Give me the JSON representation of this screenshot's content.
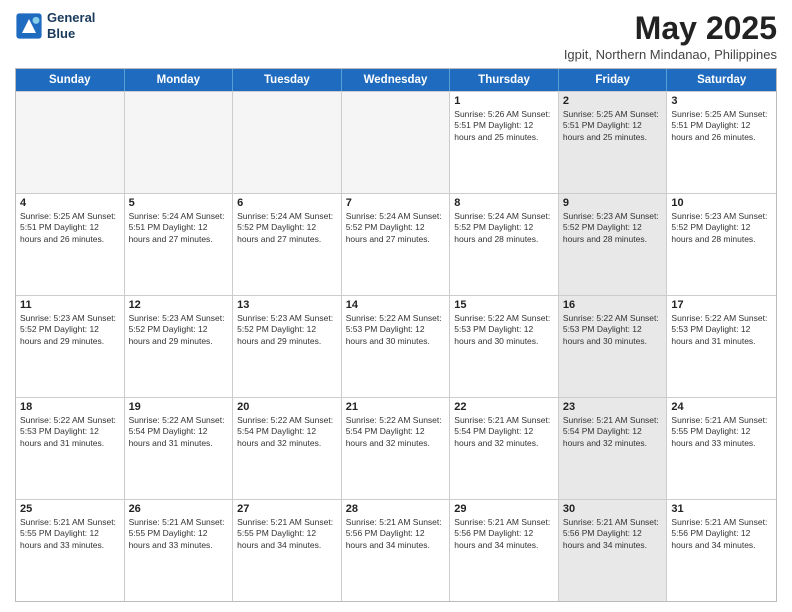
{
  "header": {
    "logo_line1": "General",
    "logo_line2": "Blue",
    "month_title": "May 2025",
    "location": "Igpit, Northern Mindanao, Philippines"
  },
  "weekdays": [
    "Sunday",
    "Monday",
    "Tuesday",
    "Wednesday",
    "Thursday",
    "Friday",
    "Saturday"
  ],
  "rows": [
    [
      {
        "day": "",
        "text": "",
        "empty": true
      },
      {
        "day": "",
        "text": "",
        "empty": true
      },
      {
        "day": "",
        "text": "",
        "empty": true
      },
      {
        "day": "",
        "text": "",
        "empty": true
      },
      {
        "day": "1",
        "text": "Sunrise: 5:26 AM\nSunset: 5:51 PM\nDaylight: 12 hours\nand 25 minutes.",
        "empty": false,
        "shaded": false
      },
      {
        "day": "2",
        "text": "Sunrise: 5:25 AM\nSunset: 5:51 PM\nDaylight: 12 hours\nand 25 minutes.",
        "empty": false,
        "shaded": true
      },
      {
        "day": "3",
        "text": "Sunrise: 5:25 AM\nSunset: 5:51 PM\nDaylight: 12 hours\nand 26 minutes.",
        "empty": false,
        "shaded": false
      }
    ],
    [
      {
        "day": "4",
        "text": "Sunrise: 5:25 AM\nSunset: 5:51 PM\nDaylight: 12 hours\nand 26 minutes.",
        "empty": false,
        "shaded": false
      },
      {
        "day": "5",
        "text": "Sunrise: 5:24 AM\nSunset: 5:51 PM\nDaylight: 12 hours\nand 27 minutes.",
        "empty": false,
        "shaded": false
      },
      {
        "day": "6",
        "text": "Sunrise: 5:24 AM\nSunset: 5:52 PM\nDaylight: 12 hours\nand 27 minutes.",
        "empty": false,
        "shaded": false
      },
      {
        "day": "7",
        "text": "Sunrise: 5:24 AM\nSunset: 5:52 PM\nDaylight: 12 hours\nand 27 minutes.",
        "empty": false,
        "shaded": false
      },
      {
        "day": "8",
        "text": "Sunrise: 5:24 AM\nSunset: 5:52 PM\nDaylight: 12 hours\nand 28 minutes.",
        "empty": false,
        "shaded": false
      },
      {
        "day": "9",
        "text": "Sunrise: 5:23 AM\nSunset: 5:52 PM\nDaylight: 12 hours\nand 28 minutes.",
        "empty": false,
        "shaded": true
      },
      {
        "day": "10",
        "text": "Sunrise: 5:23 AM\nSunset: 5:52 PM\nDaylight: 12 hours\nand 28 minutes.",
        "empty": false,
        "shaded": false
      }
    ],
    [
      {
        "day": "11",
        "text": "Sunrise: 5:23 AM\nSunset: 5:52 PM\nDaylight: 12 hours\nand 29 minutes.",
        "empty": false,
        "shaded": false
      },
      {
        "day": "12",
        "text": "Sunrise: 5:23 AM\nSunset: 5:52 PM\nDaylight: 12 hours\nand 29 minutes.",
        "empty": false,
        "shaded": false
      },
      {
        "day": "13",
        "text": "Sunrise: 5:23 AM\nSunset: 5:52 PM\nDaylight: 12 hours\nand 29 minutes.",
        "empty": false,
        "shaded": false
      },
      {
        "day": "14",
        "text": "Sunrise: 5:22 AM\nSunset: 5:53 PM\nDaylight: 12 hours\nand 30 minutes.",
        "empty": false,
        "shaded": false
      },
      {
        "day": "15",
        "text": "Sunrise: 5:22 AM\nSunset: 5:53 PM\nDaylight: 12 hours\nand 30 minutes.",
        "empty": false,
        "shaded": false
      },
      {
        "day": "16",
        "text": "Sunrise: 5:22 AM\nSunset: 5:53 PM\nDaylight: 12 hours\nand 30 minutes.",
        "empty": false,
        "shaded": true
      },
      {
        "day": "17",
        "text": "Sunrise: 5:22 AM\nSunset: 5:53 PM\nDaylight: 12 hours\nand 31 minutes.",
        "empty": false,
        "shaded": false
      }
    ],
    [
      {
        "day": "18",
        "text": "Sunrise: 5:22 AM\nSunset: 5:53 PM\nDaylight: 12 hours\nand 31 minutes.",
        "empty": false,
        "shaded": false
      },
      {
        "day": "19",
        "text": "Sunrise: 5:22 AM\nSunset: 5:54 PM\nDaylight: 12 hours\nand 31 minutes.",
        "empty": false,
        "shaded": false
      },
      {
        "day": "20",
        "text": "Sunrise: 5:22 AM\nSunset: 5:54 PM\nDaylight: 12 hours\nand 32 minutes.",
        "empty": false,
        "shaded": false
      },
      {
        "day": "21",
        "text": "Sunrise: 5:22 AM\nSunset: 5:54 PM\nDaylight: 12 hours\nand 32 minutes.",
        "empty": false,
        "shaded": false
      },
      {
        "day": "22",
        "text": "Sunrise: 5:21 AM\nSunset: 5:54 PM\nDaylight: 12 hours\nand 32 minutes.",
        "empty": false,
        "shaded": false
      },
      {
        "day": "23",
        "text": "Sunrise: 5:21 AM\nSunset: 5:54 PM\nDaylight: 12 hours\nand 32 minutes.",
        "empty": false,
        "shaded": true
      },
      {
        "day": "24",
        "text": "Sunrise: 5:21 AM\nSunset: 5:55 PM\nDaylight: 12 hours\nand 33 minutes.",
        "empty": false,
        "shaded": false
      }
    ],
    [
      {
        "day": "25",
        "text": "Sunrise: 5:21 AM\nSunset: 5:55 PM\nDaylight: 12 hours\nand 33 minutes.",
        "empty": false,
        "shaded": false
      },
      {
        "day": "26",
        "text": "Sunrise: 5:21 AM\nSunset: 5:55 PM\nDaylight: 12 hours\nand 33 minutes.",
        "empty": false,
        "shaded": false
      },
      {
        "day": "27",
        "text": "Sunrise: 5:21 AM\nSunset: 5:55 PM\nDaylight: 12 hours\nand 34 minutes.",
        "empty": false,
        "shaded": false
      },
      {
        "day": "28",
        "text": "Sunrise: 5:21 AM\nSunset: 5:56 PM\nDaylight: 12 hours\nand 34 minutes.",
        "empty": false,
        "shaded": false
      },
      {
        "day": "29",
        "text": "Sunrise: 5:21 AM\nSunset: 5:56 PM\nDaylight: 12 hours\nand 34 minutes.",
        "empty": false,
        "shaded": false
      },
      {
        "day": "30",
        "text": "Sunrise: 5:21 AM\nSunset: 5:56 PM\nDaylight: 12 hours\nand 34 minutes.",
        "empty": false,
        "shaded": true
      },
      {
        "day": "31",
        "text": "Sunrise: 5:21 AM\nSunset: 5:56 PM\nDaylight: 12 hours\nand 34 minutes.",
        "empty": false,
        "shaded": false
      }
    ]
  ]
}
